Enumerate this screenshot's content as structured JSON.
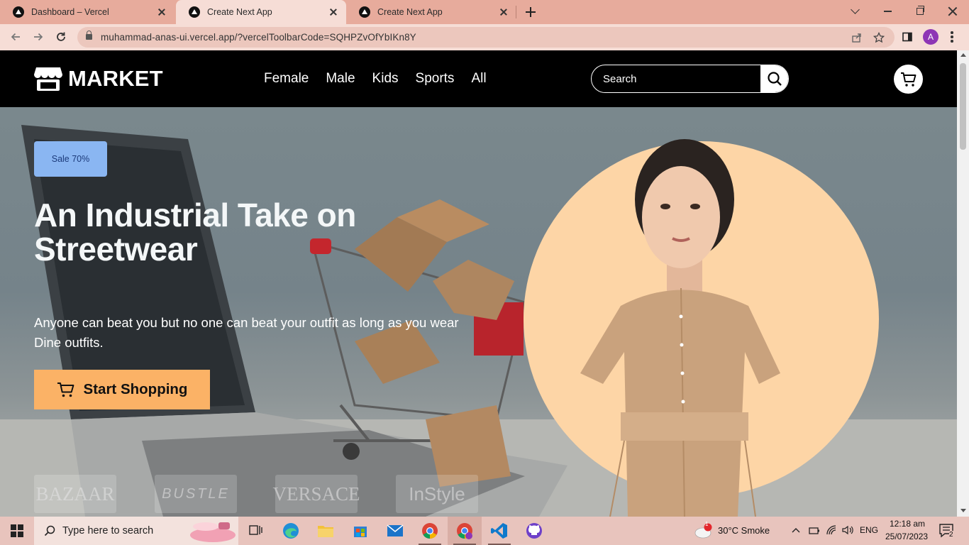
{
  "browser": {
    "tabs": [
      {
        "title": "Dashboard – Vercel",
        "active": false
      },
      {
        "title": "Create Next App",
        "active": true
      },
      {
        "title": "Create Next App",
        "active": false
      }
    ],
    "url": "muhammad-anas-ui.vercel.app/?vercelToolbarCode=SQHPZvOfYbIKn8Y",
    "profile_initial": "A"
  },
  "site": {
    "logo_text": "MARKET",
    "nav": [
      "Female",
      "Male",
      "Kids",
      "Sports",
      "All"
    ],
    "search_placeholder": "Search"
  },
  "hero": {
    "badge": "Sale 70%",
    "headline": "An Industrial Take on Streetwear",
    "subtext": "Anyone can beat you but no one can beat your outfit as long as you wear Dine outfits.",
    "cta_label": "Start Shopping",
    "brands": [
      "BAZAAR",
      "BUSTLE",
      "VERSACE",
      "InStyle"
    ]
  },
  "taskbar": {
    "search_placeholder": "Type here to search",
    "weather": "30°C  Smoke",
    "language": "ENG",
    "time": "12:18 am",
    "date": "25/07/2023",
    "notification_count": "2",
    "weather_badge": "1"
  },
  "colors": {
    "accent": "#fbb266",
    "badge": "#8ab6f2",
    "circle": "#fdd5a6",
    "tabstrip": "#e7ab9c"
  }
}
